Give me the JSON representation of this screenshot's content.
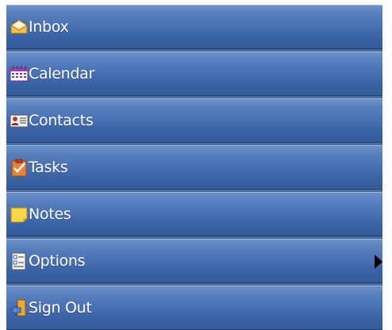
{
  "menu": {
    "items": [
      {
        "label": "Inbox",
        "icon": "envelope-icon"
      },
      {
        "label": "Calendar",
        "icon": "calendar-icon"
      },
      {
        "label": "Contacts",
        "icon": "contact-card-icon"
      },
      {
        "label": "Tasks",
        "icon": "task-clipboard-icon"
      },
      {
        "label": "Notes",
        "icon": "sticky-note-icon"
      },
      {
        "label": "Options",
        "icon": "options-form-icon",
        "has_submenu": true
      },
      {
        "label": "Sign Out",
        "icon": "sign-out-icon"
      }
    ]
  },
  "colors": {
    "item_gradient_top": "#6c91c9",
    "item_gradient_bottom": "#345a99",
    "text": "#ffffff",
    "submenu_arrow": "#000000"
  }
}
